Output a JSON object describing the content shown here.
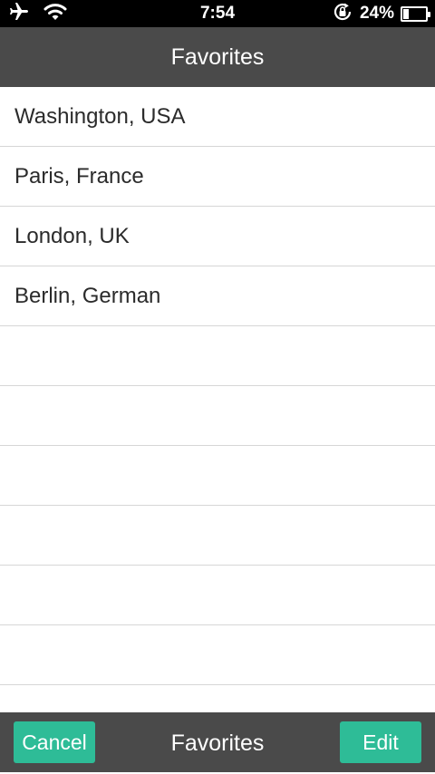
{
  "status_bar": {
    "time": "7:54",
    "battery_percent": "24%",
    "battery_level": 0.24,
    "icons": [
      "airplane-icon",
      "wifi-icon",
      "rotation-lock-icon",
      "battery-icon"
    ]
  },
  "nav": {
    "title": "Favorites"
  },
  "favorites": {
    "items": [
      "Washington, USA",
      "Paris, France",
      "London, UK",
      "Berlin, German",
      "",
      "",
      "",
      "",
      "",
      "",
      ""
    ]
  },
  "toolbar": {
    "cancel_label": "Cancel",
    "title": "Favorites",
    "edit_label": "Edit"
  },
  "colors": {
    "accent": "#2ebc97",
    "bar_background": "#4a4a4a",
    "status_bar": "#000000",
    "separator": "#d6d6d6"
  }
}
